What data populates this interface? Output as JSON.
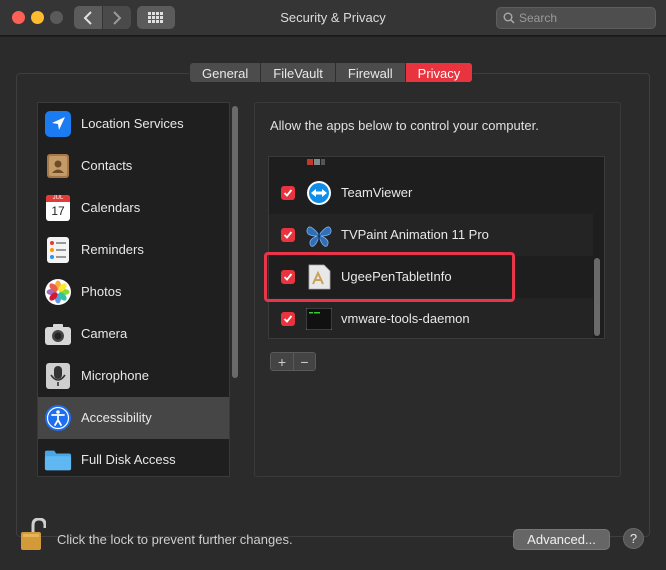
{
  "window": {
    "title": "Security & Privacy",
    "search_placeholder": "Search"
  },
  "tabs": [
    {
      "label": "General",
      "active": false
    },
    {
      "label": "FileVault",
      "active": false
    },
    {
      "label": "Firewall",
      "active": false
    },
    {
      "label": "Privacy",
      "active": true
    }
  ],
  "sidebar": {
    "items": [
      {
        "label": "Location Services",
        "icon": "location-arrow-icon"
      },
      {
        "label": "Contacts",
        "icon": "contacts-book-icon"
      },
      {
        "label": "Calendars",
        "icon": "calendar-icon",
        "icon_month": "JUL",
        "icon_day": "17"
      },
      {
        "label": "Reminders",
        "icon": "reminders-list-icon"
      },
      {
        "label": "Photos",
        "icon": "photos-flower-icon"
      },
      {
        "label": "Camera",
        "icon": "camera-icon"
      },
      {
        "label": "Microphone",
        "icon": "microphone-icon"
      },
      {
        "label": "Accessibility",
        "icon": "accessibility-icon",
        "selected": true
      },
      {
        "label": "Full Disk Access",
        "icon": "folder-icon"
      }
    ]
  },
  "content": {
    "description": "Allow the apps below to control your computer.",
    "apps": [
      {
        "name": "TeamViewer",
        "checked": true,
        "icon": "teamviewer-icon"
      },
      {
        "name": "TVPaint Animation 11 Pro",
        "checked": true,
        "icon": "butterfly-icon"
      },
      {
        "name": "UgeePenTabletInfo",
        "checked": true,
        "icon": "app-generic-icon"
      },
      {
        "name": "vmware-tools-daemon",
        "checked": true,
        "icon": "terminal-icon"
      }
    ],
    "add_label": "+",
    "remove_label": "−"
  },
  "footer": {
    "lock_text": "Click the lock to prevent further changes.",
    "advanced_label": "Advanced...",
    "help_label": "?"
  },
  "colors": {
    "accent": "#e9343f",
    "highlight_box": "#e8354a",
    "window_bg": "#2b2b2b",
    "titlebar_bg": "#353535"
  }
}
